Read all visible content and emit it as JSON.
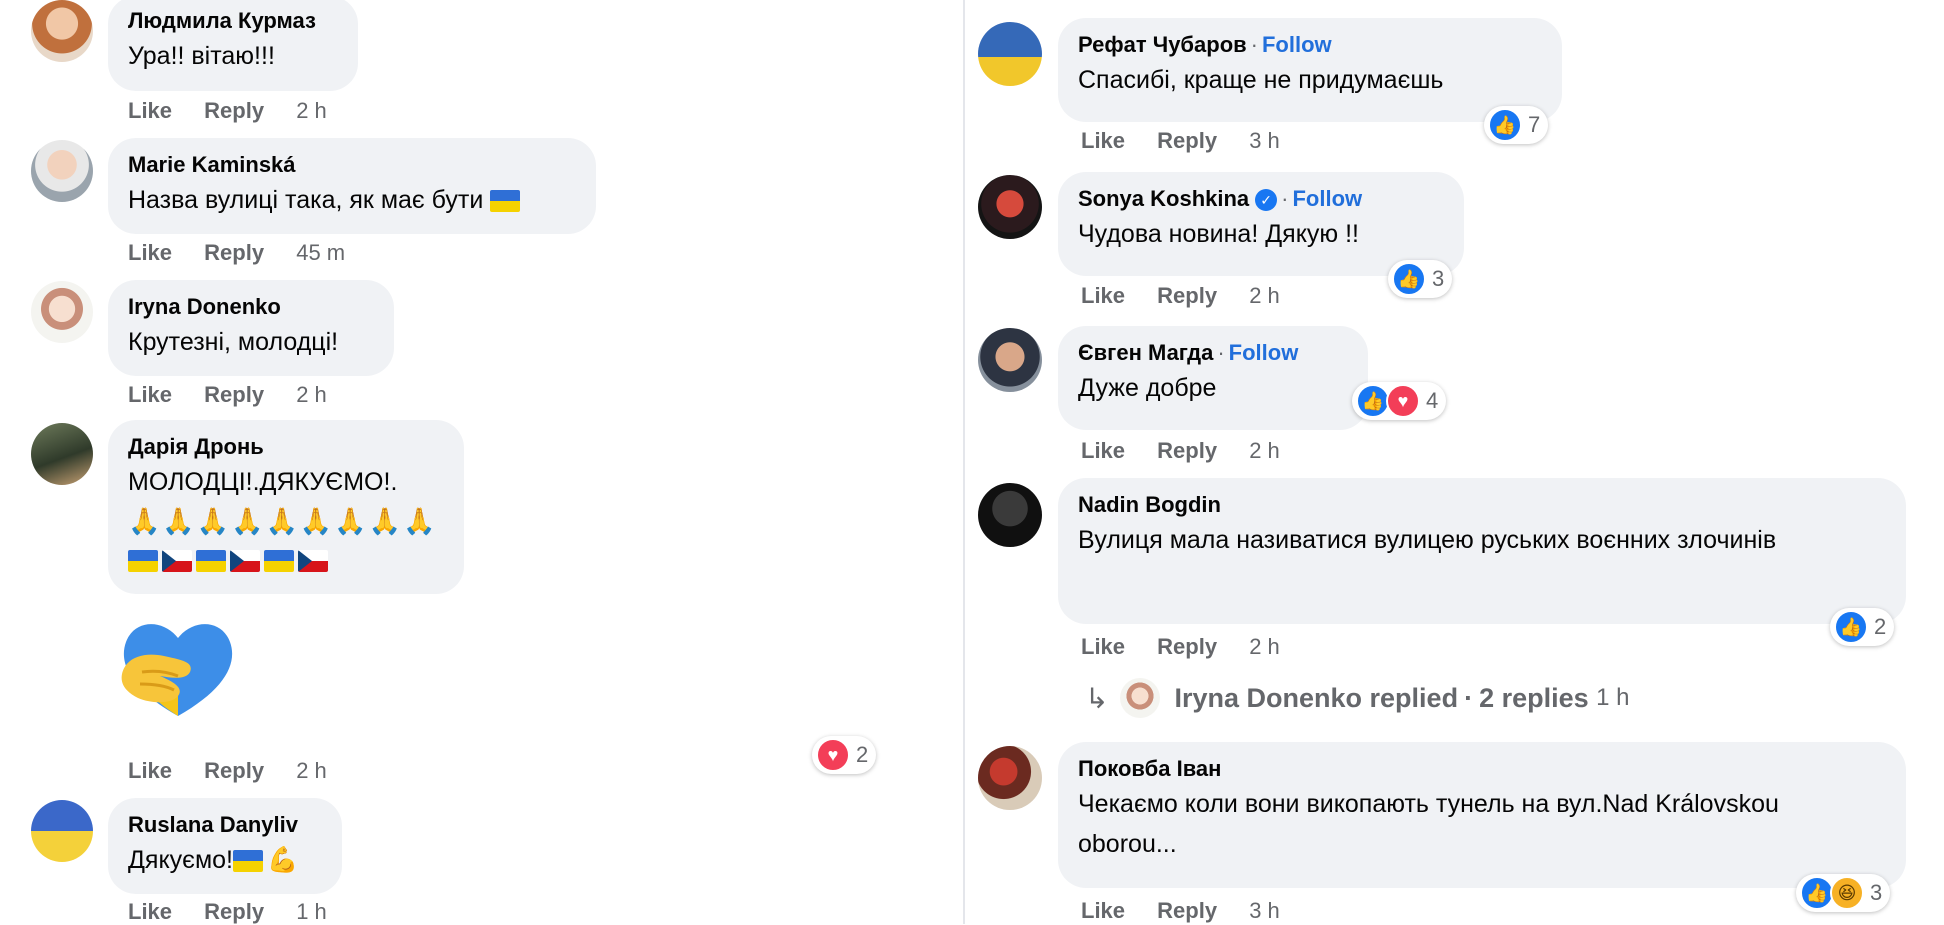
{
  "actions": {
    "like": "Like",
    "reply": "Reply"
  },
  "left_comments": [
    {
      "author": "Людмила Курмаз",
      "text": "Ура!! вітаю!!!",
      "time": "2 h"
    },
    {
      "author": "Marie Kaminská",
      "text": "Назва вулиці така, як має бути",
      "time": "45 m"
    },
    {
      "author": "Iryna Donenko",
      "text": "Крутезні, молодці!",
      "time": "2 h"
    },
    {
      "author": "Дарія Дронь",
      "text": "МОЛОДЦІ!.ДЯКУЄМО!.",
      "time": "2 h",
      "reaction_count": "2"
    },
    {
      "author": "Ruslana Danyliv",
      "text": "Дякуємо!",
      "time": "1 h"
    }
  ],
  "right_comments": [
    {
      "author": "Рефат Чубаров",
      "follow": "Follow",
      "text": "Спасибі, краще не придумаєшь",
      "time": "3 h",
      "reaction_count": "7"
    },
    {
      "author": "Sonya Koshkina",
      "follow": "Follow",
      "text": "Чудова новина! Дякую !!",
      "time": "2 h",
      "reaction_count": "3"
    },
    {
      "author": "Євген Магда",
      "follow": "Follow",
      "text": "Дуже добре",
      "time": "2 h",
      "reaction_count": "4"
    },
    {
      "author": "Nadin Bogdin",
      "text": "Вулиця мала називатися вулицею руських воєнних злочинів",
      "time": "2 h",
      "reaction_count": "2",
      "replies": {
        "author": "Iryna Donenko",
        "verb": "replied",
        "count": "2 replies",
        "time": "1 h"
      }
    },
    {
      "author": "Поковба Іван",
      "text": "Чекаємо коли вони викопають тунель на вул.Nad Královskou oborou...",
      "time": "3 h",
      "reaction_count": "3"
    }
  ],
  "colors": {
    "bubble": "#f0f2f5",
    "link": "#216fdb",
    "meta": "#65676b",
    "like": "#1877f2",
    "love": "#f33e58"
  }
}
